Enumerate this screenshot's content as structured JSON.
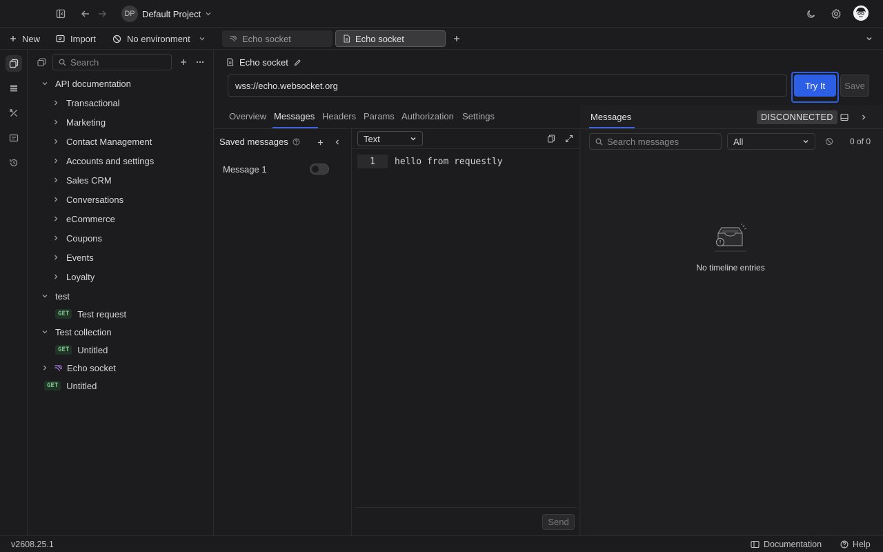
{
  "project": {
    "initials": "DP",
    "name": "Default Project"
  },
  "toolbar": {
    "new_label": "New",
    "import_label": "Import",
    "environment": "No environment"
  },
  "sidebar": {
    "search_placeholder": "Search",
    "tree": [
      {
        "label": "API documentation",
        "type": "folder",
        "open": true
      },
      {
        "label": "Transactional",
        "type": "folder"
      },
      {
        "label": "Marketing",
        "type": "folder"
      },
      {
        "label": "Contact Management",
        "type": "folder"
      },
      {
        "label": "Accounts and settings",
        "type": "folder"
      },
      {
        "label": "Sales CRM",
        "type": "folder"
      },
      {
        "label": "Conversations",
        "type": "folder"
      },
      {
        "label": "eCommerce",
        "type": "folder"
      },
      {
        "label": "Coupons",
        "type": "folder"
      },
      {
        "label": "Events",
        "type": "folder"
      },
      {
        "label": "Loyalty",
        "type": "folder"
      },
      {
        "label": "test",
        "type": "folder",
        "open": true
      },
      {
        "label": "Test request",
        "type": "request",
        "method": "GET"
      },
      {
        "label": "Test collection",
        "type": "folder",
        "open": true
      },
      {
        "label": "Untitled",
        "type": "request",
        "method": "GET"
      },
      {
        "label": "Echo socket",
        "type": "websocket"
      },
      {
        "label": "Untitled",
        "type": "request",
        "method": "GET"
      }
    ]
  },
  "tabs": [
    {
      "label": "Echo socket"
    },
    {
      "label": "Echo socket"
    }
  ],
  "request": {
    "title": "Echo socket",
    "url": "wss://echo.websocket.org",
    "try_label": "Try It",
    "save_label": "Save"
  },
  "subtabs": [
    "Overview",
    "Messages",
    "Headers",
    "Params",
    "Authorization",
    "Settings"
  ],
  "saved_messages": {
    "title": "Saved messages",
    "items": [
      {
        "label": "Message 1",
        "enabled": false
      }
    ]
  },
  "editor": {
    "format": "Text",
    "line_number": "1",
    "content": "hello from requestly",
    "send_label": "Send"
  },
  "timeline": {
    "tab_label": "Messages",
    "status": "DISCONNECTED",
    "search_placeholder": "Search messages",
    "filter": "All",
    "count": "0 of 0",
    "empty_text": "No timeline entries"
  },
  "footer": {
    "version": "v2608.25.1",
    "docs_label": "Documentation",
    "help_label": "Help"
  },
  "colors": {
    "accent": "#2c5fe6",
    "background": "#1c1c1e",
    "get_method": "#7ec98f",
    "websocket_icon": "#a97be0"
  }
}
